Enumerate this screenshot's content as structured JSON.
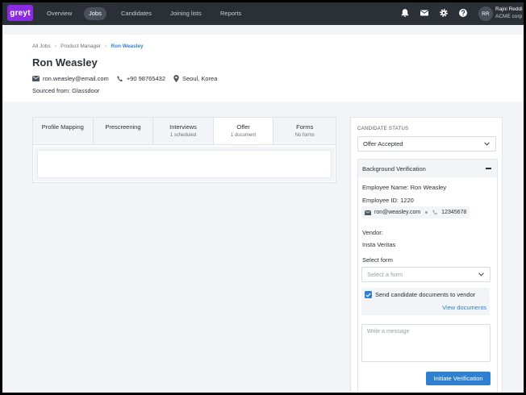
{
  "nav": {
    "logo": "greyt",
    "items": [
      {
        "label": "Overview"
      },
      {
        "label": "Jobs"
      },
      {
        "label": "Candidates"
      },
      {
        "label": "Joining lists"
      },
      {
        "label": "Reports"
      }
    ],
    "avatar_initials": "RR",
    "user_name": "Rajni Reddi",
    "user_org": "ACME corp"
  },
  "breadcrumb": {
    "items": [
      "All Jobs",
      "Product Manager",
      "Ron Weasley"
    ]
  },
  "candidate": {
    "name": "Ron Weasley",
    "email": "ron.weasley@email.com",
    "phone": "+90 98765432",
    "location": "Seoul, Korea",
    "sourced": "Sourced from: Glassdoor"
  },
  "tabs": [
    {
      "label": "Profile Mapping",
      "sub": ""
    },
    {
      "label": "Prescreening",
      "sub": ""
    },
    {
      "label": "Interviews",
      "sub": "1 scheduled"
    },
    {
      "label": "Offer",
      "sub": "1 document"
    },
    {
      "label": "Forms",
      "sub": "No forms"
    }
  ],
  "status": {
    "label": "CANDIDATE STATUS",
    "value": "Offer Accepted"
  },
  "bv": {
    "title": "Background Verification",
    "employee_name": "Employee Name: Ron Weasley",
    "employee_id": "Employee ID: 1220",
    "email": "ron@weasley.com",
    "phone": "12345678",
    "vendor_label": "Vendor:",
    "vendor_value": "Insta Veritas",
    "select_form_label": "Select form",
    "select_form_placeholder": "Select a form",
    "send_docs_label": "Send candidate documents to vendor",
    "view_docs": "View documents",
    "message_placeholder": "Write a message",
    "initiate_button": "Initiate Verification"
  },
  "colors": {
    "accent": "#2f80d1",
    "brand": "#8a2be2",
    "nav_bg": "#2b2f36"
  }
}
